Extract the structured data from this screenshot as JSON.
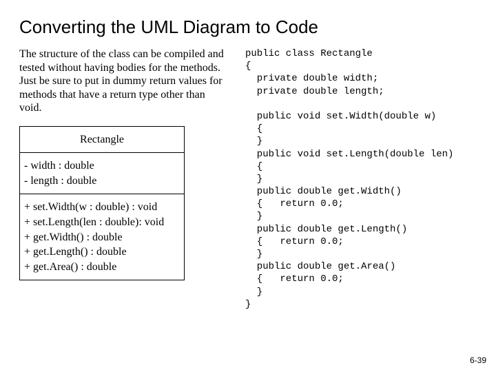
{
  "title": "Converting the UML Diagram to Code",
  "description": "The structure of the class can be compiled and tested without having bodies for the methods.  Just be sure to put in dummy return values for methods that have a return type other than void.",
  "uml": {
    "className": "Rectangle",
    "attributes": "- width : double\n- length : double",
    "methods": "+ set.Width(w : double) : void\n+ set.Length(len : double): void\n+ get.Width() : double\n+ get.Length() : double\n+ get.Area() : double"
  },
  "code": "public class Rectangle\n{\n  private double width;\n  private double length;\n\n  public void set.Width(double w)\n  {\n  }\n  public void set.Length(double len)\n  {\n  }\n  public double get.Width()\n  {   return 0.0;\n  }\n  public double get.Length()\n  {   return 0.0;\n  }\n  public double get.Area()\n  {   return 0.0;\n  }\n}",
  "pageNumber": "6-39"
}
